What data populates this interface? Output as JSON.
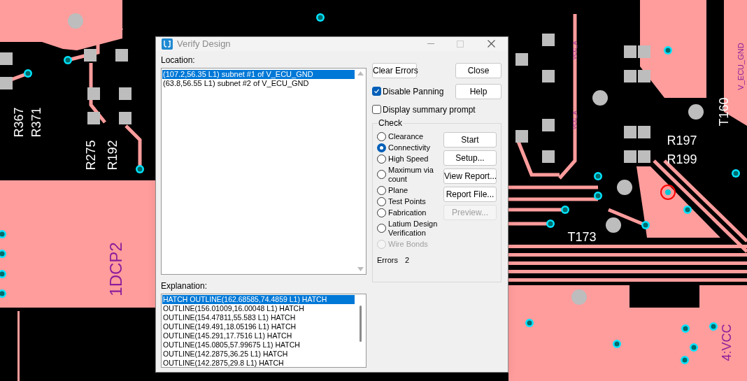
{
  "board": {
    "labels": [
      {
        "text": "R367",
        "kind": "silk"
      },
      {
        "text": "R371",
        "kind": "silk"
      },
      {
        "text": "R275",
        "kind": "silk"
      },
      {
        "text": "R192",
        "kind": "silk"
      },
      {
        "text": "1DCP2",
        "kind": "net"
      },
      {
        "text": "VCC_A",
        "kind": "net"
      },
      {
        "text": "VCC_A",
        "kind": "net"
      },
      {
        "text": "R197",
        "kind": "silk"
      },
      {
        "text": "R199",
        "kind": "silk"
      },
      {
        "text": "T160",
        "kind": "silk"
      },
      {
        "text": "V_ECU_GND",
        "kind": "net"
      },
      {
        "text": "T173",
        "kind": "silk"
      },
      {
        "text": "4:VCC",
        "kind": "net"
      }
    ]
  },
  "dialog": {
    "title": "Verify Design",
    "location_label": "Location:",
    "locations": [
      {
        "text": "(107.2,56.35 L1) subnet #1 of V_ECU_GND",
        "selected": true
      },
      {
        "text": "(63.8,56.55 L1) subnet #2 of V_ECU_GND",
        "selected": false
      }
    ],
    "explanation_label": "Explanation:",
    "explanations": [
      {
        "text": "HATCH OUTLINE(162.68585,74.4859 L1) HATCH",
        "selected": true
      },
      {
        "text": "OUTLINE(156.01009,16.00048 L1) HATCH",
        "selected": false
      },
      {
        "text": "OUTLINE(154.47811,55.583 L1) HATCH",
        "selected": false
      },
      {
        "text": "OUTLINE(149.491,18.05196 L1) HATCH",
        "selected": false
      },
      {
        "text": "OUTLINE(145.291,17.7516 L1) HATCH",
        "selected": false
      },
      {
        "text": "OUTLINE(145.0805,57.99675 L1) HATCH",
        "selected": false
      },
      {
        "text": "OUTLINE(142.2875,36.25 L1) HATCH",
        "selected": false
      },
      {
        "text": "OUTLINE(142.2875,29.8 L1) HATCH",
        "selected": false
      }
    ],
    "clear_errors": "Clear Errors",
    "close": "Close",
    "help": "Help",
    "disable_panning": {
      "label": "Disable Panning",
      "checked": true
    },
    "display_summary": {
      "label": "Display summary prompt",
      "checked": false
    },
    "check": {
      "title": "Check",
      "options": [
        {
          "label": "Clearance",
          "selected": false,
          "disabled": false
        },
        {
          "label": "Connectivity",
          "selected": true,
          "disabled": false
        },
        {
          "label": "High Speed",
          "selected": false,
          "disabled": false
        },
        {
          "label": "Maximum via count",
          "selected": false,
          "disabled": false
        },
        {
          "label": "Plane",
          "selected": false,
          "disabled": false
        },
        {
          "label": "Test Points",
          "selected": false,
          "disabled": false
        },
        {
          "label": "Fabrication",
          "selected": false,
          "disabled": false
        },
        {
          "label": "Latium Design Verification",
          "selected": false,
          "disabled": false
        },
        {
          "label": "Wire Bonds",
          "selected": false,
          "disabled": true
        }
      ],
      "actions": [
        {
          "label": "Start",
          "disabled": false
        },
        {
          "label": "Setup...",
          "disabled": false
        },
        {
          "label": "View Report...",
          "disabled": false
        },
        {
          "label": "Report File...",
          "disabled": false
        },
        {
          "label": "Preview...",
          "disabled": true
        }
      ],
      "errors_label": "Errors",
      "errors_count": "2"
    }
  }
}
